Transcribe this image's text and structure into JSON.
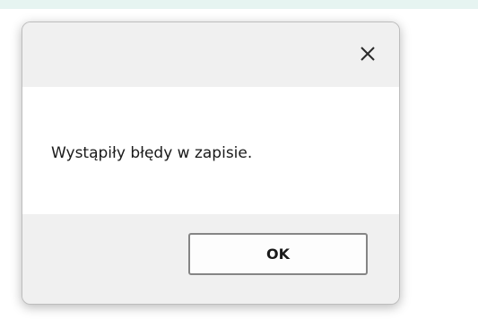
{
  "dialog": {
    "close_icon": "close-icon",
    "message": "Wystąpiły błędy w zapisie.",
    "ok_label": "OK"
  },
  "colors": {
    "top_strip": "#e6f4f1",
    "dialog_background": "#f0f0f0",
    "content_background": "#ffffff",
    "button_border": "#858585",
    "text": "#1a1a1a"
  }
}
